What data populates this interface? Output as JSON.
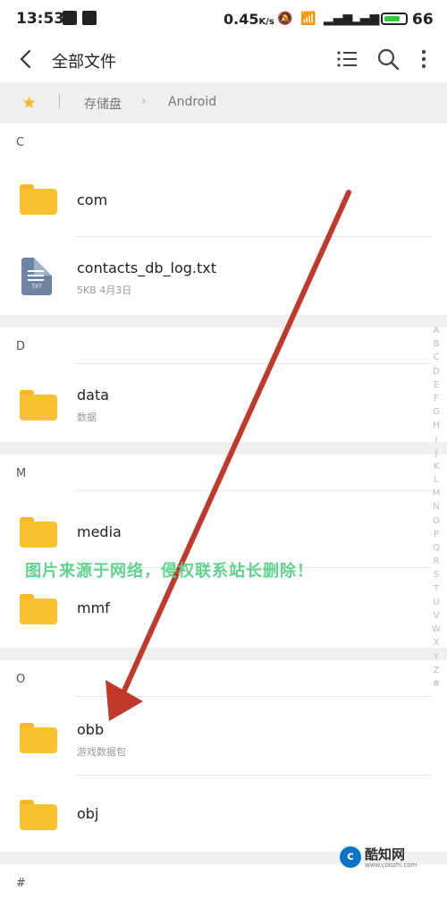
{
  "status_bar": {
    "time": "13:53",
    "speed": "0.45",
    "speed_unit": "K/s",
    "battery": "66"
  },
  "app_bar": {
    "title": "全部文件"
  },
  "breadcrumb": {
    "items": [
      "存储盘",
      "Android"
    ]
  },
  "sections": [
    {
      "letter": "C",
      "items": [
        {
          "name": "com",
          "type": "folder",
          "sub": ""
        },
        {
          "name": "contacts_db_log.txt",
          "type": "file",
          "sub": "5KB  4月3日",
          "file_tag": "TXT"
        }
      ]
    },
    {
      "letter": "D",
      "items": [
        {
          "name": "data",
          "type": "folder",
          "sub": "数据"
        }
      ]
    },
    {
      "letter": "M",
      "items": [
        {
          "name": "media",
          "type": "folder",
          "sub": ""
        },
        {
          "name": "mmf",
          "type": "folder",
          "sub": ""
        }
      ]
    },
    {
      "letter": "O",
      "items": [
        {
          "name": "obb",
          "type": "folder",
          "sub": "游戏数据包"
        },
        {
          "name": "obj",
          "type": "folder",
          "sub": ""
        }
      ]
    },
    {
      "letter": "#",
      "items": []
    }
  ],
  "alpha_index": [
    "A",
    "B",
    "C",
    "D",
    "E",
    "F",
    "G",
    "H",
    "I",
    "J",
    "K",
    "L",
    "M",
    "N",
    "O",
    "P",
    "Q",
    "R",
    "S",
    "T",
    "U",
    "V",
    "W",
    "X",
    "Y",
    "Z",
    "#"
  ],
  "watermark": "图片来源于网络，侵权联系站长删除！",
  "logo": {
    "badge": "c",
    "brand": "酷知网",
    "url": "www.coozhi.com"
  },
  "colors": {
    "folder": "#fbc02d",
    "star": "#f7b731",
    "arrow": "#c0392b",
    "watermark": "#5fd38d"
  }
}
